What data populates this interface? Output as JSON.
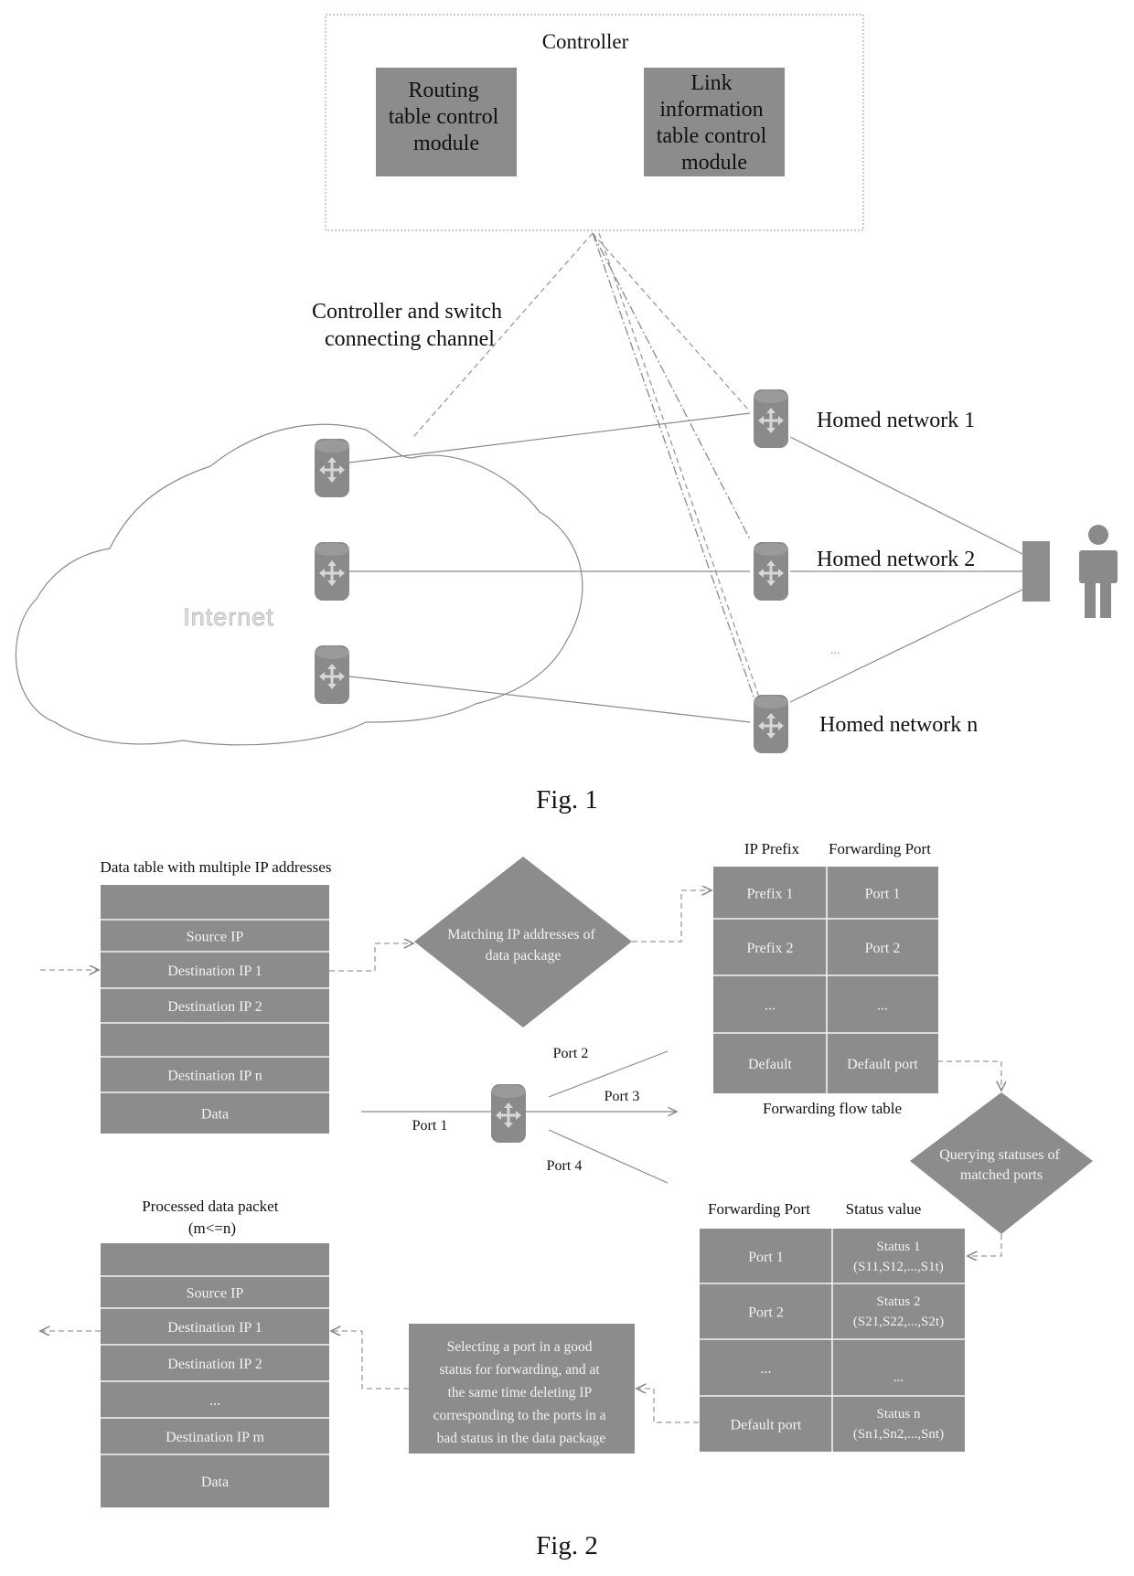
{
  "fig1": {
    "controller": {
      "title": "Controller",
      "modules": [
        {
          "lines": [
            "Routing",
            "table control",
            "module"
          ]
        },
        {
          "lines": [
            "Link",
            "information",
            "table control",
            "module"
          ]
        }
      ]
    },
    "channel_label": [
      "Controller and switch",
      "connecting channel"
    ],
    "cloud_label": "Internet",
    "homed_networks": [
      "Homed network 1",
      "Homed network 2",
      "Homed network n"
    ],
    "ellipsis": "...",
    "caption": "Fig. 1"
  },
  "fig2": {
    "input_table": {
      "title": "Data table with multiple IP addresses",
      "rows": [
        "",
        "Source IP",
        "Destination IP 1",
        "Destination IP 2",
        "",
        "Destination IP n",
        "Data"
      ]
    },
    "match_diamond": [
      "Matching IP addresses of",
      "data package"
    ],
    "flow_table": {
      "headers": [
        "IP Prefix",
        "Forwarding Port"
      ],
      "rows": [
        [
          "Prefix 1",
          "Port 1"
        ],
        [
          "Prefix 2",
          "Port 2"
        ],
        [
          "...",
          "..."
        ],
        [
          "Default",
          "Default port"
        ]
      ],
      "caption": "Forwarding flow table"
    },
    "switch_ports": [
      "Port 1",
      "Port 2",
      "Port 3",
      "Port 4"
    ],
    "query_diamond": [
      "Querying statuses of",
      "matched ports"
    ],
    "status_table": {
      "headers": [
        "Forwarding Port",
        "Status value"
      ],
      "rows": [
        {
          "port": "Port 1",
          "status": "Status 1",
          "vector": "(S11,S12,...,S1t)"
        },
        {
          "port": "Port 2",
          "status": "Status 2",
          "vector": "(S21,S22,...,S2t)"
        },
        {
          "port": "...",
          "status": "",
          "vector": "..."
        },
        {
          "port": "Default port",
          "status": "Status n",
          "vector": "(Sn1,Sn2,...,Snt)"
        }
      ]
    },
    "select_box": [
      "Selecting a port in a good",
      "status for forwarding, and at",
      "the same time deleting IP",
      "corresponding to the ports in a",
      "bad status in the data package"
    ],
    "output_table": {
      "title": [
        "Processed data packet",
        "(m<=n)"
      ],
      "rows": [
        "",
        "Source IP",
        "Destination IP 1",
        "Destination IP 2",
        "...",
        "Destination IP m",
        "Data"
      ]
    },
    "caption": "Fig. 2"
  }
}
